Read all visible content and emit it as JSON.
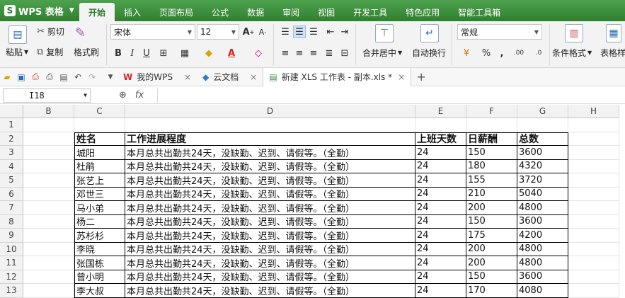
{
  "app": {
    "name": "WPS 表格",
    "logo": "S"
  },
  "menu": [
    "开始",
    "插入",
    "页面布局",
    "公式",
    "数据",
    "审阅",
    "视图",
    "开发工具",
    "特色应用",
    "智能工具箱"
  ],
  "ribbon": {
    "paste": "粘贴",
    "cut": "剪切",
    "copy": "复制",
    "format_painter": "格式刷",
    "font_name": "宋体",
    "font_size": "12",
    "merge_center": "合并居中",
    "wrap_text": "自动换行",
    "number_format": "常规",
    "conditional_format": "条件格式",
    "table_style": "表格样"
  },
  "doc_tabs": [
    {
      "label": "我的WPS"
    },
    {
      "label": "云文档"
    },
    {
      "label": "新建 XLS 工作表 - 副本.xls *"
    }
  ],
  "formula_bar": {
    "cell_ref": "I18",
    "fx": "fx",
    "zoom": "Q"
  },
  "columns": [
    "B",
    "C",
    "D",
    "E",
    "F",
    "G",
    "H"
  ],
  "rows": [
    "1",
    "2",
    "3",
    "4",
    "5",
    "6",
    "7",
    "8",
    "9",
    "10",
    "11",
    "12",
    "13"
  ],
  "table": {
    "headers": [
      "姓名",
      "工作进展程度",
      "上班天数",
      "日薪酬",
      "总数"
    ],
    "records": [
      [
        "城阳",
        "本月总共出勤共24天，没缺勤、迟到、请假等。（全勤）",
        "24",
        "150",
        "3600"
      ],
      [
        "杜鹃",
        "本月总共出勤共24天，没缺勤、迟到、请假等。（全勤）",
        "24",
        "180",
        "4320"
      ],
      [
        "张艺上",
        "本月总共出勤共24天，没缺勤、迟到、请假等。（全勤）",
        "24",
        "155",
        "3720"
      ],
      [
        "邓世三",
        "本月总共出勤共24天，没缺勤、迟到、请假等。（全勤）",
        "24",
        "210",
        "5040"
      ],
      [
        "马小弟",
        "本月总共出勤共24天，没缺勤、迟到、请假等。（全勤）",
        "24",
        "200",
        "4800"
      ],
      [
        "杨二",
        "本月总共出勤共24天，没缺勤、迟到、请假等。（全勤）",
        "24",
        "150",
        "3600"
      ],
      [
        "苏杉杉",
        "本月总共出勤共24天，没缺勤、迟到、请假等。（全勤）",
        "24",
        "175",
        "4200"
      ],
      [
        "李晓",
        "本月总共出勤共24天，没缺勤、迟到、请假等。（全勤）",
        "24",
        "200",
        "4800"
      ],
      [
        "张国栋",
        "本月总共出勤共24天，没缺勤、迟到、请假等。（全勤）",
        "24",
        "200",
        "4800"
      ],
      [
        "曾小明",
        "本月总共出勤共24天，没缺勤、迟到、请假等。（全勤）",
        "24",
        "150",
        "3600"
      ],
      [
        "李大叔",
        "本月总共出勤共24天，没缺勤、迟到、请假等。（全勤）",
        "24",
        "170",
        "4080"
      ]
    ]
  }
}
